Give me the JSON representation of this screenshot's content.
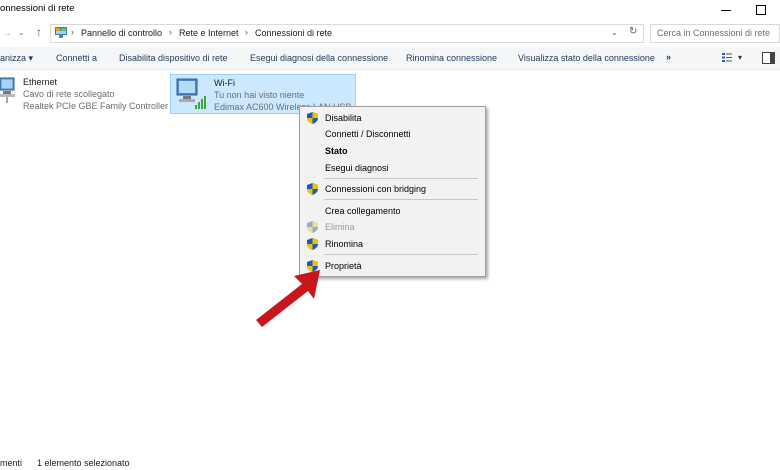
{
  "window": {
    "title": "onnessioni di rete"
  },
  "address": {
    "crumbs": [
      "Pannello di controllo",
      "Rete e Internet",
      "Connessioni di rete"
    ],
    "search_placeholder": "Cerca in Connessioni di rete"
  },
  "commands": {
    "organize": "anizza",
    "connect_to": "Connetti a",
    "disable_device": "Disabilita dispositivo di rete",
    "diagnose": "Esegui diagnosi della connessione",
    "rename": "Rinomina connessione",
    "view_status": "Visualizza stato della connessione",
    "more": "»"
  },
  "items": [
    {
      "name": "Ethernet",
      "status": "Cavo di rete scollegato",
      "device": "Realtek PCIe GBE Family Controller"
    },
    {
      "name": "Wi-Fi",
      "status": "Tu non hai visto niente",
      "device": "Edimax AC600 Wireless LAN USB"
    }
  ],
  "context_menu": {
    "items": [
      {
        "label": "Disabilita",
        "shield": true,
        "bold": false,
        "disabled": false
      },
      {
        "label": "Connetti / Disconnetti",
        "shield": false,
        "bold": false,
        "disabled": false
      },
      {
        "label": "Stato",
        "shield": false,
        "bold": true,
        "disabled": false
      },
      {
        "label": "Esegui diagnosi",
        "shield": false,
        "bold": false,
        "disabled": false
      },
      {
        "label": "Connessioni con bridging",
        "shield": true,
        "bold": false,
        "disabled": false
      },
      {
        "label": "Crea collegamento",
        "shield": false,
        "bold": false,
        "disabled": false
      },
      {
        "label": "Elimina",
        "shield": true,
        "bold": false,
        "disabled": true
      },
      {
        "label": "Rinomina",
        "shield": true,
        "bold": false,
        "disabled": false
      },
      {
        "label": "Proprietà",
        "shield": true,
        "bold": false,
        "disabled": false
      }
    ]
  },
  "status": {
    "left": "menti",
    "selection": "1 elemento selezionato"
  },
  "colors": {
    "selection_bg": "#cce8ff",
    "arrow": "#c8161d",
    "command_text": "#1e395b"
  }
}
